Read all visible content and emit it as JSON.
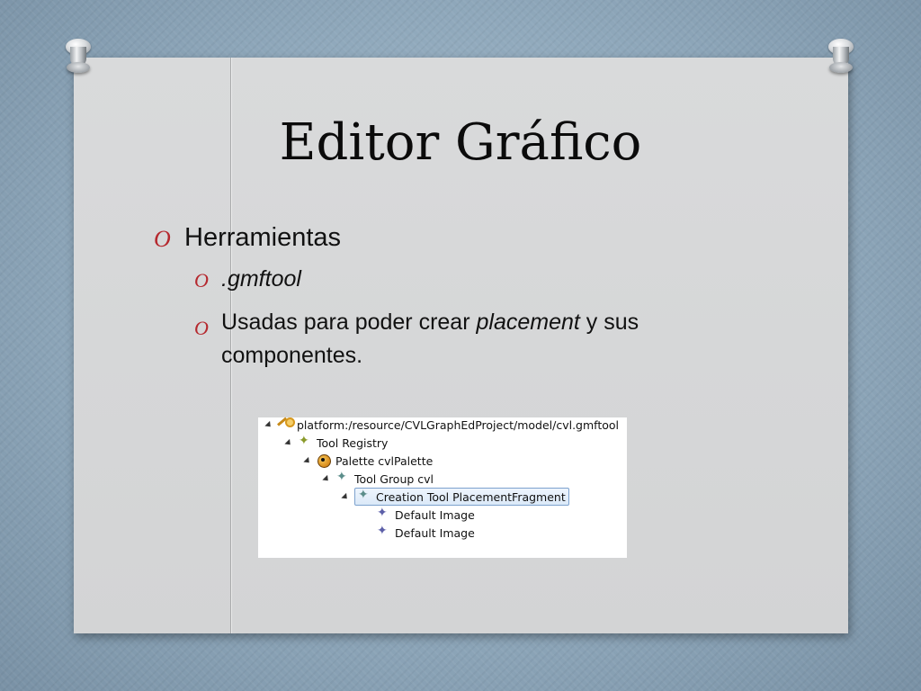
{
  "slide": {
    "title": "Editor Gráfico",
    "bullet_marker": "O",
    "bullets": [
      {
        "text": "Herramientas"
      },
      {
        "text": ".gmftool"
      },
      {
        "text_before": "Usadas para poder crear ",
        "emphasis": "placement",
        "text_after": " y sus",
        "text_line2": "componentes."
      }
    ]
  },
  "tree": {
    "items": [
      {
        "label": "platform:/resource/CVLGraphEdProject/model/cvl.gmftool",
        "icon": "key-icon"
      },
      {
        "label": "Tool Registry",
        "icon": "tool-registry-icon"
      },
      {
        "label": "Palette cvlPalette",
        "icon": "palette-icon"
      },
      {
        "label": "Tool Group cvl",
        "icon": "tool-group-icon"
      },
      {
        "label": "Creation Tool PlacementFragment",
        "icon": "creation-tool-icon"
      },
      {
        "label": "Default Image",
        "icon": "image-icon"
      },
      {
        "label": "Default Image",
        "icon": "image-icon"
      }
    ]
  },
  "colors": {
    "bullet_marker": "#b5282e",
    "paper": "#d6d7d8",
    "background": "#8fa8bb"
  }
}
